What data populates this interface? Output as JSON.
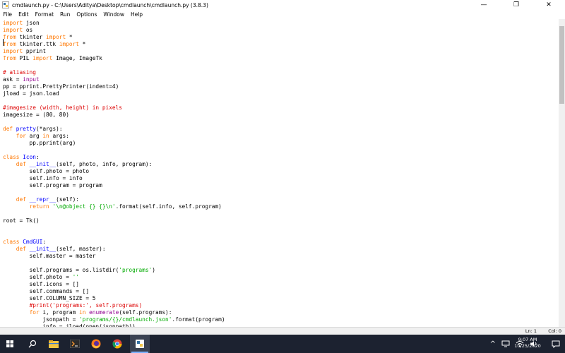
{
  "window": {
    "title": "cmdlaunch.py - C:\\Users\\Aditya\\Desktop\\cmdlaunch\\cmdlaunch.py (3.8.3)",
    "minimize": "—",
    "maximize": "❐",
    "close": "✕"
  },
  "menu": [
    "File",
    "Edit",
    "Format",
    "Run",
    "Options",
    "Window",
    "Help"
  ],
  "code_lines": [
    [
      [
        "kw",
        "import"
      ],
      [
        "n",
        " json"
      ]
    ],
    [
      [
        "kw",
        "import"
      ],
      [
        "n",
        " os"
      ]
    ],
    [
      [
        "kw",
        "from"
      ],
      [
        "n",
        " tkinter "
      ],
      [
        "kw",
        "import"
      ],
      [
        "n",
        " *"
      ]
    ],
    [
      [
        "kw",
        "from"
      ],
      [
        "n",
        " tkinter.ttk "
      ],
      [
        "kw",
        "import"
      ],
      [
        "n",
        " *"
      ]
    ],
    [
      [
        "kw",
        "import"
      ],
      [
        "n",
        " pprint"
      ]
    ],
    [
      [
        "kw",
        "from"
      ],
      [
        "n",
        " PIL "
      ],
      [
        "kw",
        "import"
      ],
      [
        "n",
        " Image, ImageTk"
      ]
    ],
    [],
    [
      [
        "cm",
        "# aliasing"
      ]
    ],
    [
      [
        "n",
        "ask = "
      ],
      [
        "bi",
        "input"
      ]
    ],
    [
      [
        "n",
        "pp = pprint.PrettyPrinter(indent=4)"
      ]
    ],
    [
      [
        "n",
        "jload = json.load"
      ]
    ],
    [],
    [
      [
        "cm",
        "#imagesize (width, height) in pixels"
      ]
    ],
    [
      [
        "n",
        "imagesize = (80, 80)"
      ]
    ],
    [],
    [
      [
        "kw",
        "def"
      ],
      [
        "n",
        " "
      ],
      [
        "df",
        "pretty"
      ],
      [
        "n",
        "(*args):"
      ]
    ],
    [
      [
        "n",
        "    "
      ],
      [
        "kw",
        "for"
      ],
      [
        "n",
        " arg "
      ],
      [
        "kw",
        "in"
      ],
      [
        "n",
        " args:"
      ]
    ],
    [
      [
        "n",
        "        pp.pprint(arg)"
      ]
    ],
    [],
    [
      [
        "kw",
        "class"
      ],
      [
        "n",
        " "
      ],
      [
        "df",
        "Icon"
      ],
      [
        "n",
        ":"
      ]
    ],
    [
      [
        "n",
        "    "
      ],
      [
        "kw",
        "def"
      ],
      [
        "n",
        " "
      ],
      [
        "df",
        "__init__"
      ],
      [
        "n",
        "(self, photo, info, program):"
      ]
    ],
    [
      [
        "n",
        "        self.photo = photo"
      ]
    ],
    [
      [
        "n",
        "        self.info = info"
      ]
    ],
    [
      [
        "n",
        "        self.program = program"
      ]
    ],
    [],
    [
      [
        "n",
        "    "
      ],
      [
        "kw",
        "def"
      ],
      [
        "n",
        " "
      ],
      [
        "df",
        "__repr__"
      ],
      [
        "n",
        "(self):"
      ]
    ],
    [
      [
        "n",
        "        "
      ],
      [
        "kw",
        "return"
      ],
      [
        "n",
        " "
      ],
      [
        "st",
        "'\\n@object {} {}\\n'"
      ],
      [
        "n",
        ".format(self.info, self.program)"
      ]
    ],
    [],
    [
      [
        "n",
        "root = Tk()"
      ]
    ],
    [],
    [],
    [
      [
        "kw",
        "class"
      ],
      [
        "n",
        " "
      ],
      [
        "df",
        "CmdGUI"
      ],
      [
        "n",
        ":"
      ]
    ],
    [
      [
        "n",
        "    "
      ],
      [
        "kw",
        "def"
      ],
      [
        "n",
        " "
      ],
      [
        "df",
        "__init__"
      ],
      [
        "n",
        "(self, master):"
      ]
    ],
    [
      [
        "n",
        "        self.master = master"
      ]
    ],
    [],
    [
      [
        "n",
        "        self.programs = os.listdir("
      ],
      [
        "st",
        "'programs'"
      ],
      [
        "n",
        ")"
      ]
    ],
    [
      [
        "n",
        "        self.photo = "
      ],
      [
        "st",
        "''"
      ]
    ],
    [
      [
        "n",
        "        self.icons = []"
      ]
    ],
    [
      [
        "n",
        "        self.commands = []"
      ]
    ],
    [
      [
        "n",
        "        self.COLUMN_SIZE = 5"
      ]
    ],
    [
      [
        "n",
        "        "
      ],
      [
        "cm",
        "#print('programs:', self.programs)"
      ]
    ],
    [
      [
        "n",
        "        "
      ],
      [
        "kw",
        "for"
      ],
      [
        "n",
        " i, program "
      ],
      [
        "kw",
        "in"
      ],
      [
        "n",
        " "
      ],
      [
        "bi",
        "enumerate"
      ],
      [
        "n",
        "(self.programs):"
      ]
    ],
    [
      [
        "n",
        "            jsonpath = "
      ],
      [
        "st",
        "'programs/{}/cmdlaunch.json'"
      ],
      [
        "n",
        ".format(program)"
      ]
    ],
    [
      [
        "n",
        "            info = jload(open(jsonpath))"
      ]
    ]
  ],
  "status": {
    "line": "Ln: 1",
    "col": "Col: 0"
  },
  "taskbar": {
    "apps": [
      "start-icon",
      "search-icon",
      "task-view-icon",
      "file-explorer-icon",
      "terminal-icon",
      "firefox-icon",
      "chrome-icon",
      "python-idle-icon"
    ],
    "tray": {
      "chevron": "^",
      "time": "9:07 AM",
      "date": "10/25/2020"
    }
  },
  "colors": {
    "keyword": "#ff7700",
    "string": "#00aa00",
    "comment": "#dd0000",
    "definition": "#0000ff",
    "builtin": "#900090",
    "taskbar": "#1c2230"
  }
}
